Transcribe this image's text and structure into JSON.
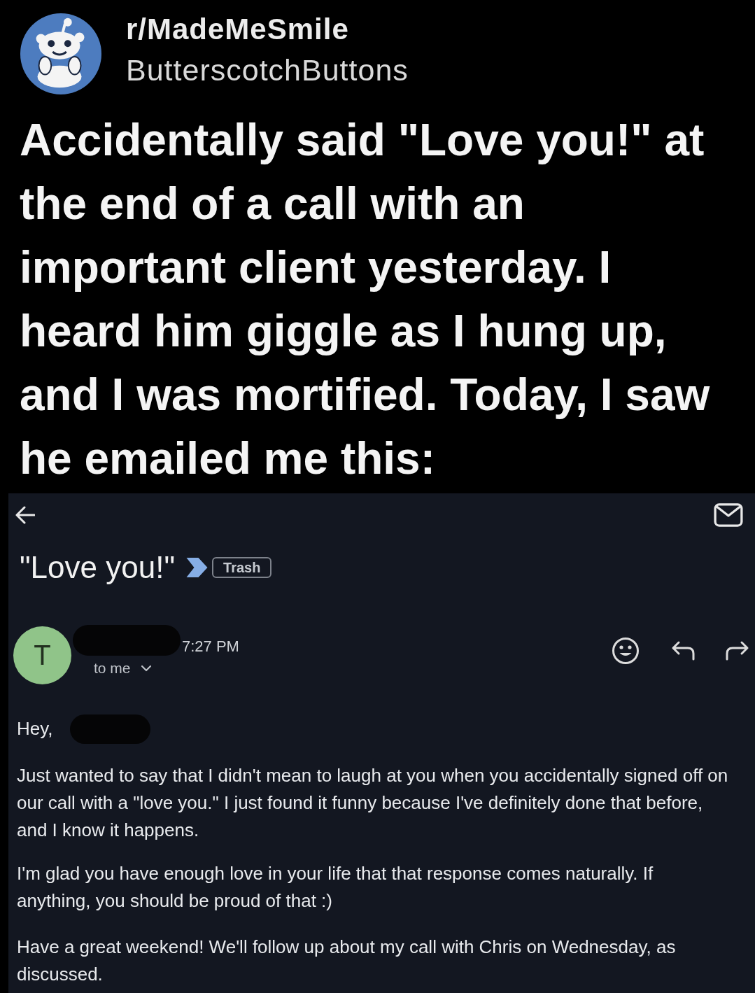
{
  "post": {
    "subreddit": "r/MadeMeSmile",
    "author": "ButterscotchButtons",
    "title": "Accidentally said \"Love you!\" at the end of a call with an important client yesterday. I heard him giggle as I hung up, and I was mortified. Today, I saw he emailed me this:"
  },
  "email": {
    "subject": "\"Love you!\"",
    "important": true,
    "label": "Trash",
    "sender_initial": "T",
    "time": "7:27 PM",
    "recipient": "to me",
    "greeting": "Hey,",
    "paragraphs": [
      "Just wanted to say that I didn't mean to laugh at you when you accidentally signed off on our call with a \"love you.\" I just found it funny because I've definitely done that before, and I know it happens.",
      "I'm glad you have enough love in your life that that response comes naturally. If anything, you should be proud of that :)",
      "Have a great weekend! We'll follow up about my call with Chris on Wednesday, as discussed."
    ]
  }
}
